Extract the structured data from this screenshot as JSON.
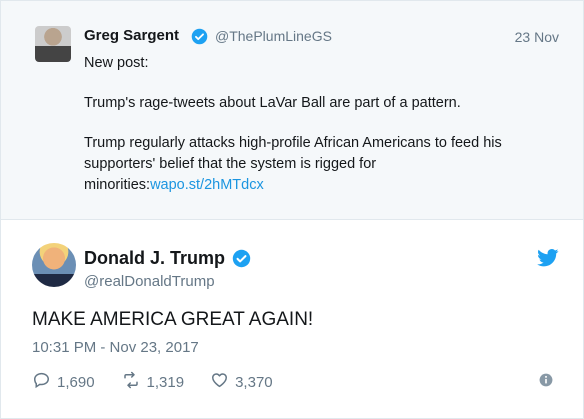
{
  "quoted_tweet": {
    "name": "Greg Sargent",
    "handle": "@ThePlumLineGS",
    "date": "23 Nov",
    "line1": "New post:",
    "line2": "Trump's rage-tweets about LaVar Ball are part of a pattern.",
    "line3_a": "Trump regularly attacks high-profile African Americans to feed his",
    "line3_b": "supporters' belief that the system is rigged for",
    "line3_c": "minorities:",
    "link": "wapo.st/2hMTdcx"
  },
  "tweet": {
    "name": "Donald J. Trump",
    "handle": "@realDonaldTrump",
    "text": "MAKE AMERICA GREAT AGAIN!",
    "timestamp": "10:31 PM - Nov 23, 2017",
    "replies": "1,690",
    "retweets": "1,319",
    "likes": "3,370"
  },
  "colors": {
    "verified": "#1da1f2",
    "link": "#1b95e0",
    "muted": "#657786",
    "quote_bg": "#f5f8fa"
  },
  "icons": [
    "verified-icon",
    "twitter-bird-icon",
    "reply-icon",
    "retweet-icon",
    "like-icon",
    "info-icon"
  ]
}
